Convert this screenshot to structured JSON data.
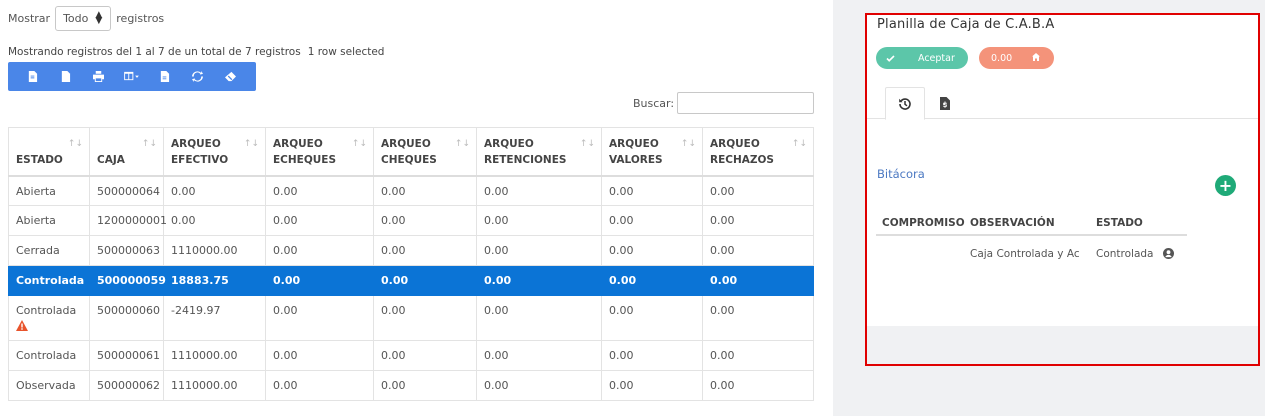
{
  "length_menu": {
    "prefix": "Mostrar",
    "selected": "Todo",
    "suffix": "registros"
  },
  "info": {
    "text": "Mostrando registros del 1 al 7 de un total de 7 registros",
    "selected_text": "1 row selected"
  },
  "toolbar": {
    "buttons": [
      {
        "icon": "copy-icon"
      },
      {
        "icon": "file-icon"
      },
      {
        "icon": "print-icon"
      },
      {
        "icon": "columns-icon"
      },
      {
        "icon": "csv-icon"
      },
      {
        "icon": "refresh-icon"
      },
      {
        "icon": "eraser-icon"
      }
    ]
  },
  "search": {
    "label": "Buscar:",
    "value": ""
  },
  "table": {
    "headers": [
      {
        "line1": "ESTADO",
        "line2": "",
        "sort": "↑↓"
      },
      {
        "line1": "CAJA",
        "line2": "",
        "sort": "↑↓"
      },
      {
        "line1": "ARQUEO",
        "line2": "EFECTIVO",
        "sort": "↑↓"
      },
      {
        "line1": "ARQUEO",
        "line2": "ECHEQUES",
        "sort": "↑↓"
      },
      {
        "line1": "ARQUEO",
        "line2": "CHEQUES",
        "sort": "↑↓"
      },
      {
        "line1": "ARQUEO",
        "line2": "RETENCIONES",
        "sort": "↑↓"
      },
      {
        "line1": "ARQUEO",
        "line2": "VALORES",
        "sort": "↑↓"
      },
      {
        "line1": "ARQUEO",
        "line2": "RECHAZOS",
        "sort": "↑↓"
      }
    ],
    "rows": [
      {
        "estado": "Abierta",
        "caja": "500000064",
        "efectivo": "0.00",
        "echeques": "0.00",
        "cheques": "0.00",
        "retenciones": "0.00",
        "valores": "0.00",
        "rechazos": "0.00"
      },
      {
        "estado": "Abierta",
        "caja": "1200000001",
        "efectivo": "0.00",
        "echeques": "0.00",
        "cheques": "0.00",
        "retenciones": "0.00",
        "valores": "0.00",
        "rechazos": "0.00"
      },
      {
        "estado": "Cerrada",
        "caja": "500000063",
        "efectivo": "1110000.00",
        "echeques": "0.00",
        "cheques": "0.00",
        "retenciones": "0.00",
        "valores": "0.00",
        "rechazos": "0.00"
      },
      {
        "estado": "Controlada",
        "caja": "500000059",
        "efectivo": "18883.75",
        "echeques": "0.00",
        "cheques": "0.00",
        "retenciones": "0.00",
        "valores": "0.00",
        "rechazos": "0.00"
      },
      {
        "estado": "Controlada",
        "caja": "500000060",
        "efectivo": "-2419.97",
        "echeques": "0.00",
        "cheques": "0.00",
        "retenciones": "0.00",
        "valores": "0.00",
        "rechazos": "0.00"
      },
      {
        "estado": "Controlada",
        "caja": "500000061",
        "efectivo": "1110000.00",
        "echeques": "0.00",
        "cheques": "0.00",
        "retenciones": "0.00",
        "valores": "0.00",
        "rechazos": "0.00"
      },
      {
        "estado": "Observada",
        "caja": "500000062",
        "efectivo": "1110000.00",
        "echeques": "0.00",
        "cheques": "0.00",
        "retenciones": "0.00",
        "valores": "0.00",
        "rechazos": "0.00"
      }
    ]
  },
  "panel": {
    "title": "Planilla de Caja de C.A.B.A",
    "accept_label": "Aceptar",
    "amount_label": "0.00",
    "section_title": "Bitácora",
    "log_headers": {
      "compromiso": "COMPROMISO",
      "observacion": "OBSERVACIÓN",
      "estado": "ESTADO"
    },
    "log_rows": [
      {
        "compromiso": "",
        "observacion": "Caja Controlada y Ac",
        "estado": "Controlada"
      }
    ]
  },
  "colors": {
    "toolbar": "#4a86e8",
    "selected_row": "#0b74d6",
    "accept": "#5cc6a9",
    "amount": "#f4937a",
    "add": "#1faa78",
    "highlight_border": "#e00000",
    "link": "#4c79c2"
  }
}
